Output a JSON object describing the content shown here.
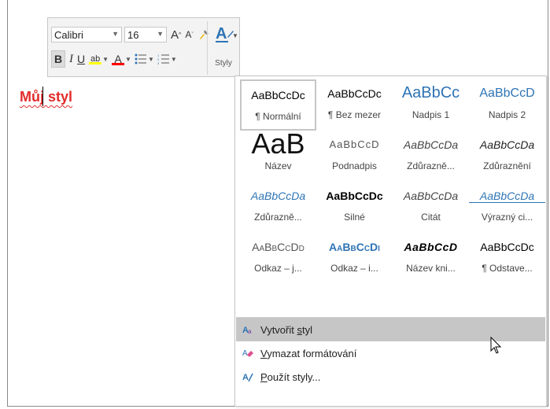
{
  "toolbar": {
    "font_name": "Calibri",
    "font_size": "16",
    "styles_label": "Styly",
    "bold": "B",
    "italic": "I",
    "underline": "U",
    "font_color_letter": "A",
    "highlight_letters": "ab"
  },
  "document": {
    "text": "Můj styl"
  },
  "gallery": {
    "styles": [
      {
        "sample": "AaBbCcDc",
        "name": "¶ Normální",
        "selected": true,
        "cls": ""
      },
      {
        "sample": "AaBbCcDc",
        "name": "¶ Bez mezer",
        "cls": ""
      },
      {
        "sample": "AaBbCc",
        "name": "Nadpis 1",
        "cls": "s-heading1"
      },
      {
        "sample": "AaBbCcD",
        "name": "Nadpis 2",
        "cls": "s-heading2"
      },
      {
        "sample": "AaB",
        "name": "Název",
        "cls": "s-title"
      },
      {
        "sample": "AaBbCcD",
        "name": "Podnadpis",
        "cls": "s-subtitle"
      },
      {
        "sample": "AaBbCcDa",
        "name": "Zdůrazně...",
        "cls": "s-subtle"
      },
      {
        "sample": "AaBbCcDa",
        "name": "Zdůraznění",
        "cls": "s-emph"
      },
      {
        "sample": "AaBbCcDa",
        "name": "Zdůrazně...",
        "cls": "s-intense"
      },
      {
        "sample": "AaBbCcDc",
        "name": "Silné",
        "cls": "s-strong"
      },
      {
        "sample": "AaBbCcDa",
        "name": "Citát",
        "cls": "s-quote"
      },
      {
        "sample": "AaBbCcDa",
        "name": "Výrazný ci...",
        "cls": "s-iquote"
      },
      {
        "sample": "AaBbCcDd",
        "name": "Odkaz – j...",
        "cls": "s-sref"
      },
      {
        "sample": "AaBbCcDi",
        "name": "Odkaz – i...",
        "cls": "s-iref"
      },
      {
        "sample": "AaBbCcD",
        "name": "Název kni...",
        "cls": "s-book"
      },
      {
        "sample": "AaBbCcDc",
        "name": "¶ Odstave...",
        "cls": ""
      }
    ],
    "menu": {
      "create_style": {
        "pre": "Vytvořit ",
        "ul": "s",
        "post": "tyl"
      },
      "clear_formatting": {
        "pre": "",
        "ul": "V",
        "post": "ymazat formátování"
      },
      "apply_styles": {
        "pre": "",
        "ul": "P",
        "post": "oužít styly..."
      }
    }
  },
  "colors": {
    "doc_text": "#e32b2b",
    "heading_blue": "#2e74b5",
    "highlight_yellow": "#ffff00",
    "font_red": "#ff0000",
    "hover_gray": "#c6c6c6"
  }
}
